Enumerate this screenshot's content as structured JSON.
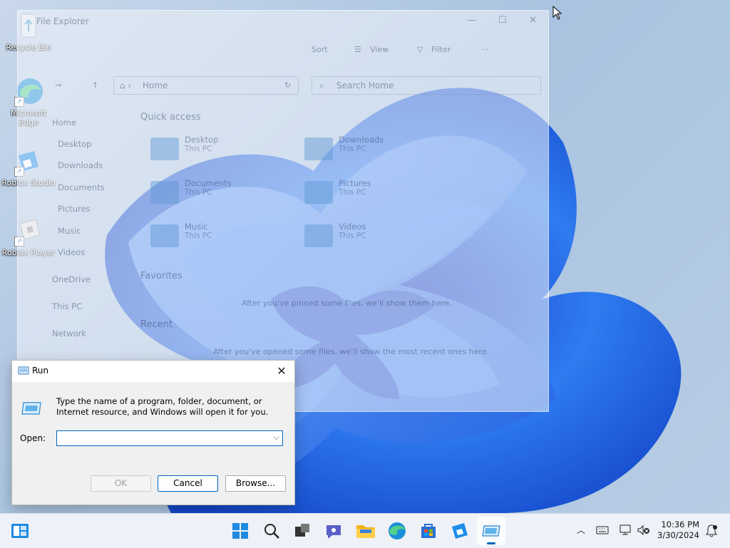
{
  "desktop": {
    "icons": [
      {
        "label": "Recycle Bin"
      },
      {
        "label": "Microsoft Edge"
      },
      {
        "label": "Roblox Studio"
      },
      {
        "label": "Roblox Player"
      }
    ]
  },
  "explorer": {
    "title": "File Explorer",
    "toolbar": {
      "sort": "Sort",
      "view": "View",
      "filter": "Filter",
      "more": "···"
    },
    "address": "Home",
    "search_placeholder": "Search Home",
    "nav": [
      "Home",
      "Desktop",
      "Downloads",
      "Documents",
      "Pictures",
      "Music",
      "Videos",
      "OneDrive",
      "This PC",
      "Network"
    ],
    "sections": {
      "quick": "Quick access",
      "favorites": "Favorites",
      "recent": "Recent"
    },
    "tiles": [
      {
        "name": "Desktop",
        "sub": "This PC"
      },
      {
        "name": "Downloads",
        "sub": "This PC"
      },
      {
        "name": "Documents",
        "sub": "This PC"
      },
      {
        "name": "Pictures",
        "sub": "This PC"
      },
      {
        "name": "Music",
        "sub": "This PC"
      },
      {
        "name": "Videos",
        "sub": "This PC"
      }
    ],
    "favorites_hint": "After you've pinned some files, we'll show them here.",
    "recent_hint": "After you've opened some files, we'll show the most recent ones here."
  },
  "run": {
    "title": "Run",
    "description": "Type the name of a program, folder, document, or Internet resource, and Windows will open it for you.",
    "open_label": "Open:",
    "open_value": "",
    "ok": "OK",
    "cancel": "Cancel",
    "browse": "Browse..."
  },
  "taskbar": {
    "time": "10:36 PM",
    "date": "3/30/2024"
  },
  "colors": {
    "accent": "#0067c0",
    "taskbar": "#eef1f7",
    "dialog": "#f0f0f0"
  }
}
